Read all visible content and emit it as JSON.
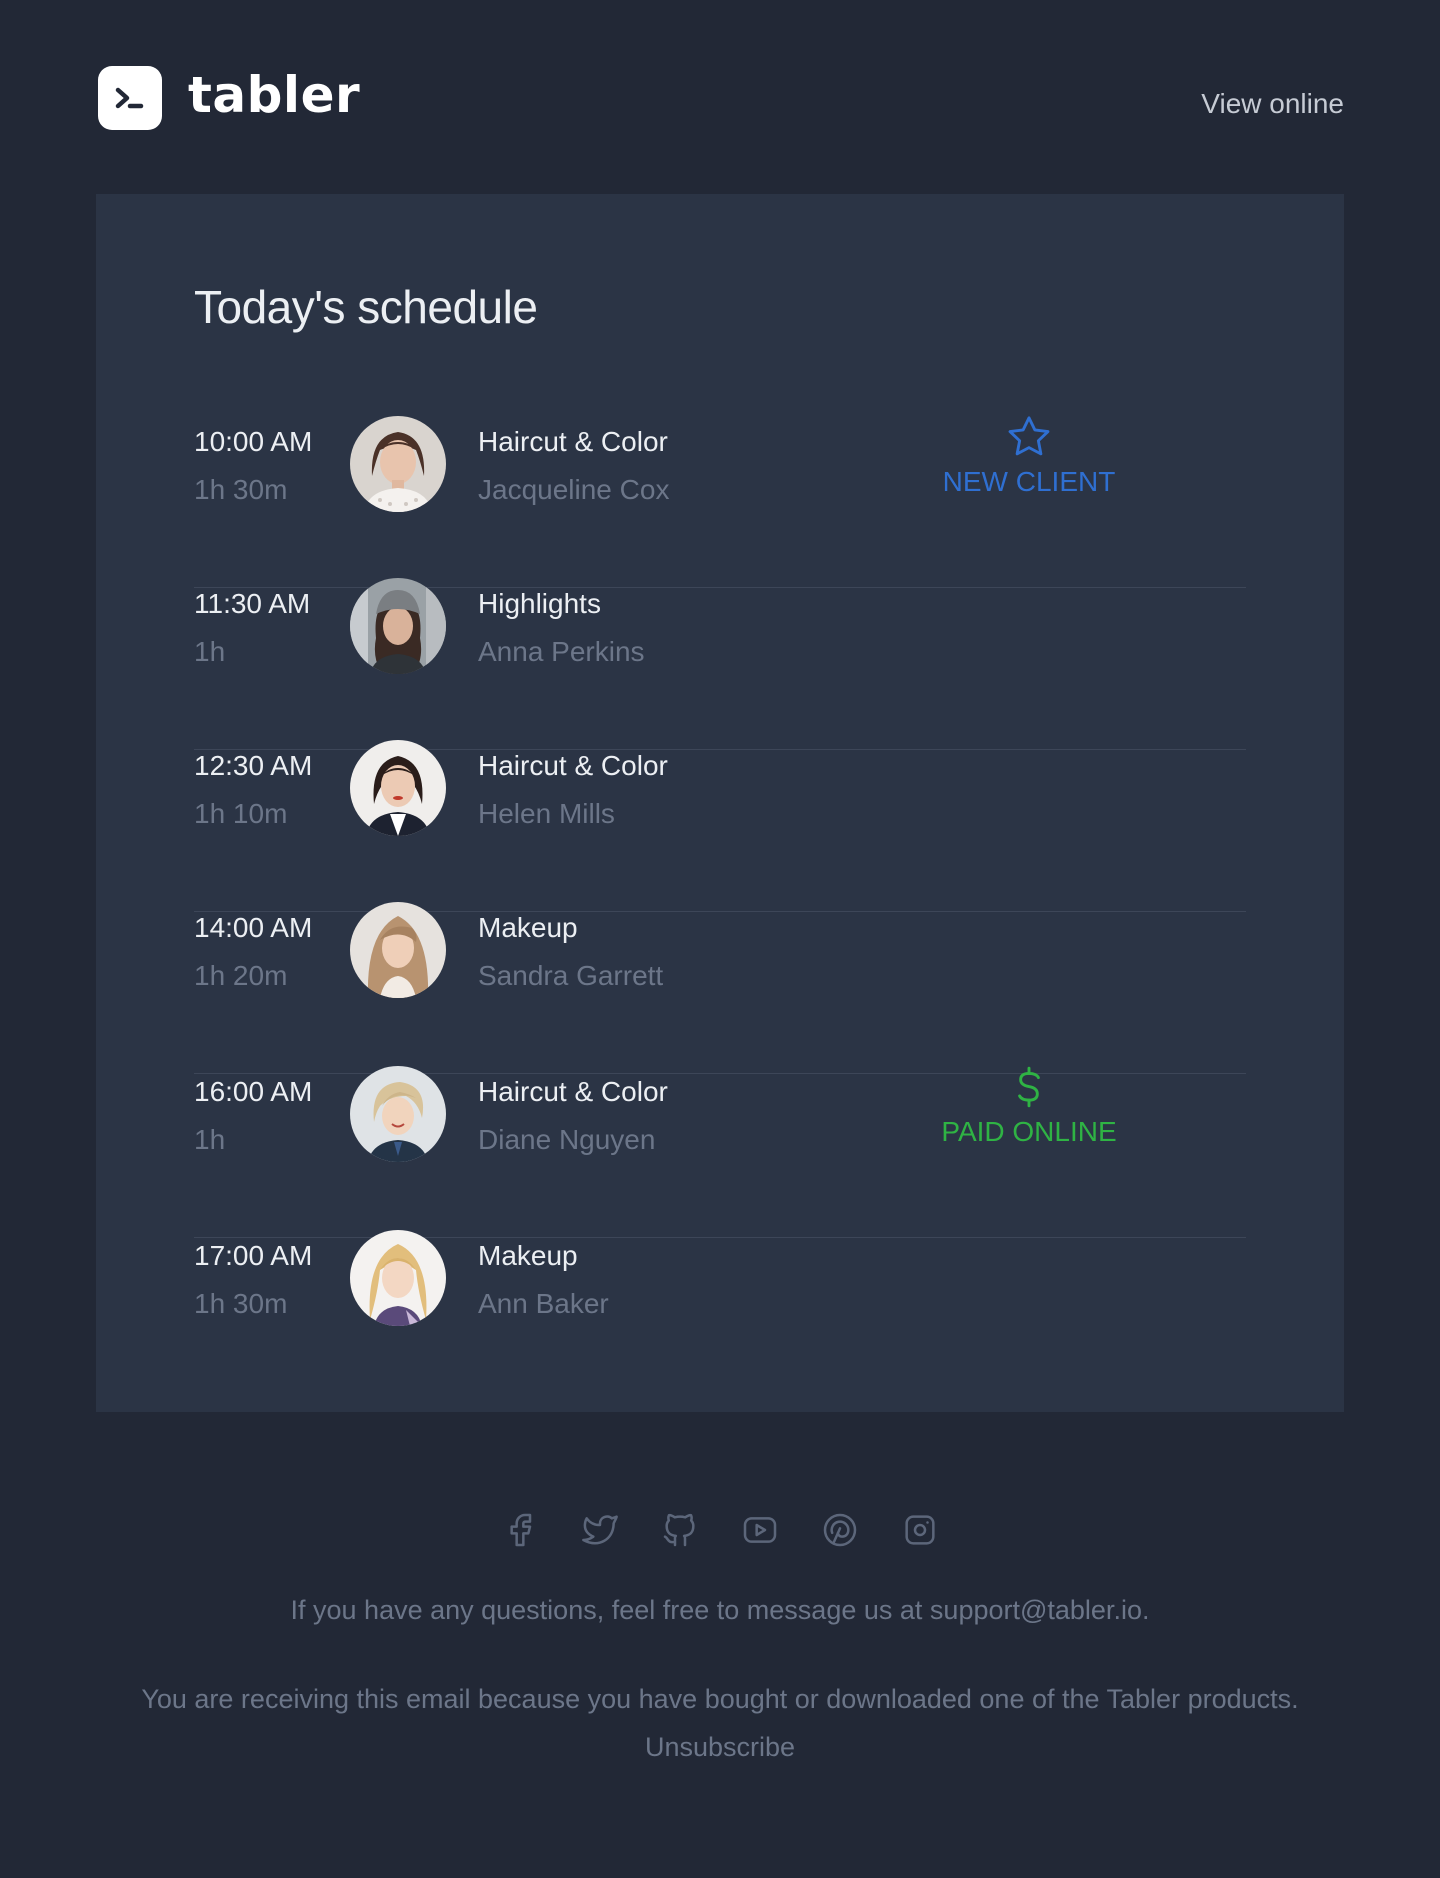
{
  "header": {
    "logo_text": "tabler",
    "view_online": "View online"
  },
  "card": {
    "title": "Today's schedule",
    "appointments": [
      {
        "time": "10:00 AM",
        "duration": "1h 30m",
        "service": "Haircut & Color",
        "client": "Jacqueline Cox",
        "badge": {
          "label": "NEW CLIENT",
          "icon": "star-icon",
          "color": "#2f6fd1"
        }
      },
      {
        "time": "11:30 AM",
        "duration": "1h",
        "service": "Highlights",
        "client": "Anna Perkins"
      },
      {
        "time": "12:30 AM",
        "duration": "1h 10m",
        "service": "Haircut & Color",
        "client": "Helen Mills"
      },
      {
        "time": "14:00 AM",
        "duration": "1h 20m",
        "service": "Makeup",
        "client": "Sandra Garrett"
      },
      {
        "time": "16:00 AM",
        "duration": "1h",
        "service": "Haircut & Color",
        "client": "Diane Nguyen",
        "badge": {
          "label": "PAID ONLINE",
          "icon": "dollar-icon",
          "color": "#2fb344"
        }
      },
      {
        "time": "17:00 AM",
        "duration": "1h 30m",
        "service": "Makeup",
        "client": "Ann Baker"
      }
    ]
  },
  "footer": {
    "social_icons": [
      "facebook-icon",
      "twitter-icon",
      "github-icon",
      "youtube-icon",
      "pinterest-icon",
      "instagram-icon"
    ],
    "questions_text": "If you have any questions, feel free to message us at",
    "support_email": "support@tabler.io",
    "questions_end": ".",
    "receiving_text": "You are receiving this email because you have bought or downloaded one of the Tabler products.",
    "unsubscribe": "Unsubscribe"
  },
  "colors": {
    "background": "#222836",
    "card": "#2b3445",
    "accent_blue": "#2f6fd1",
    "accent_green": "#2fb344",
    "muted": "#6c7689"
  }
}
